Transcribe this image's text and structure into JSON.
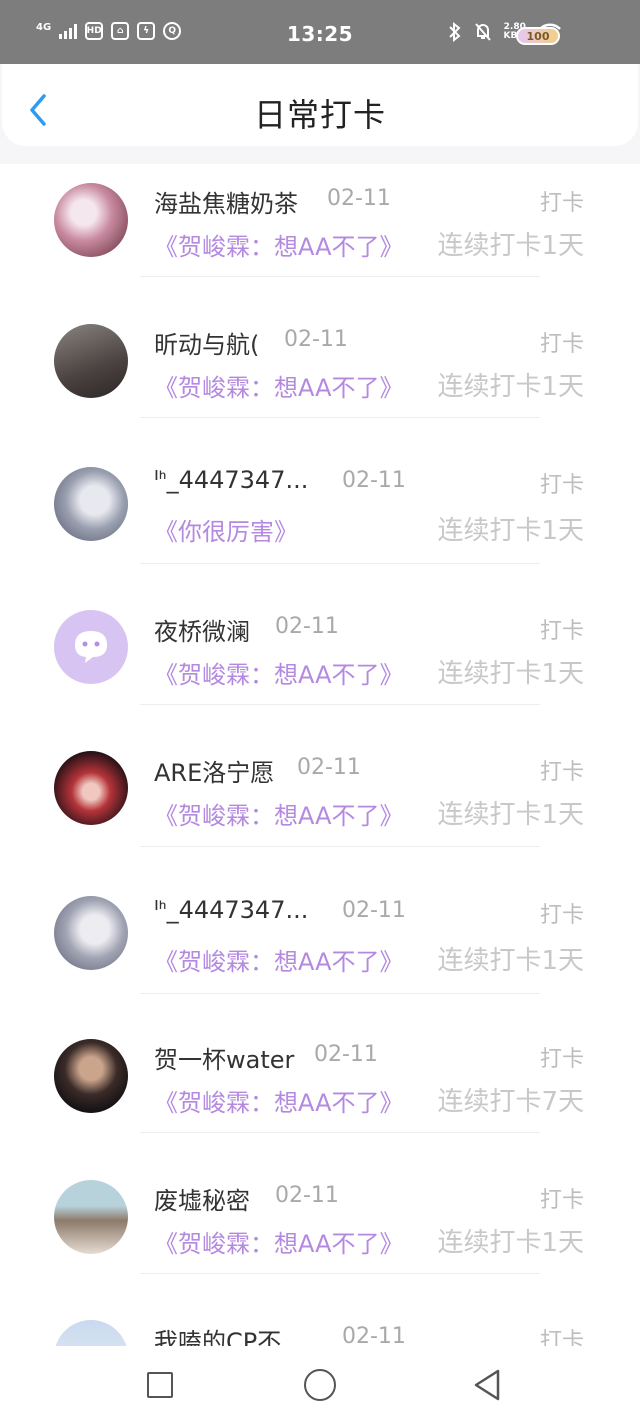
{
  "status_bar": {
    "network": "4G",
    "hd": "HD",
    "time": "13:25",
    "speed_value": "2.80",
    "speed_unit": "KB/s",
    "battery": "100"
  },
  "header": {
    "title": "日常打卡"
  },
  "colors": {
    "accent": "#2f9bf0",
    "topic": "#b489e0",
    "muted": "#c8c8c8"
  },
  "items": [
    {
      "name": "海盐焦糖奶茶",
      "date": "02-11",
      "tag": "打卡",
      "topic": "《贺峻霖：想AA不了》",
      "streak": "连续打卡1天"
    },
    {
      "name": "昕动与航(",
      "date": "02-11",
      "tag": "打卡",
      "topic": "《贺峻霖：想AA不了》",
      "streak": "连续打卡1天"
    },
    {
      "name": "ᑊᑋ_4447347...",
      "date": "02-11",
      "tag": "打卡",
      "topic": "《你很厉害》",
      "streak": "连续打卡1天"
    },
    {
      "name": "夜桥微澜",
      "date": "02-11",
      "tag": "打卡",
      "topic": "《贺峻霖：想AA不了》",
      "streak": "连续打卡1天"
    },
    {
      "name": "ARE洛宁愿",
      "date": "02-11",
      "tag": "打卡",
      "topic": "《贺峻霖：想AA不了》",
      "streak": "连续打卡1天"
    },
    {
      "name": "ᑊᑋ_4447347...",
      "date": "02-11",
      "tag": "打卡",
      "topic": "《贺峻霖：想AA不了》",
      "streak": "连续打卡1天"
    },
    {
      "name": "贺一杯water",
      "date": "02-11",
      "tag": "打卡",
      "topic": "《贺峻霖：想AA不了》",
      "streak": "连续打卡7天"
    },
    {
      "name": "废墟秘密",
      "date": "02-11",
      "tag": "打卡",
      "topic": "《贺峻霖：想AA不了》",
      "streak": "连续打卡1天"
    },
    {
      "name": "我嗑的CP不...",
      "date": "02-11",
      "tag": "打卡"
    }
  ]
}
